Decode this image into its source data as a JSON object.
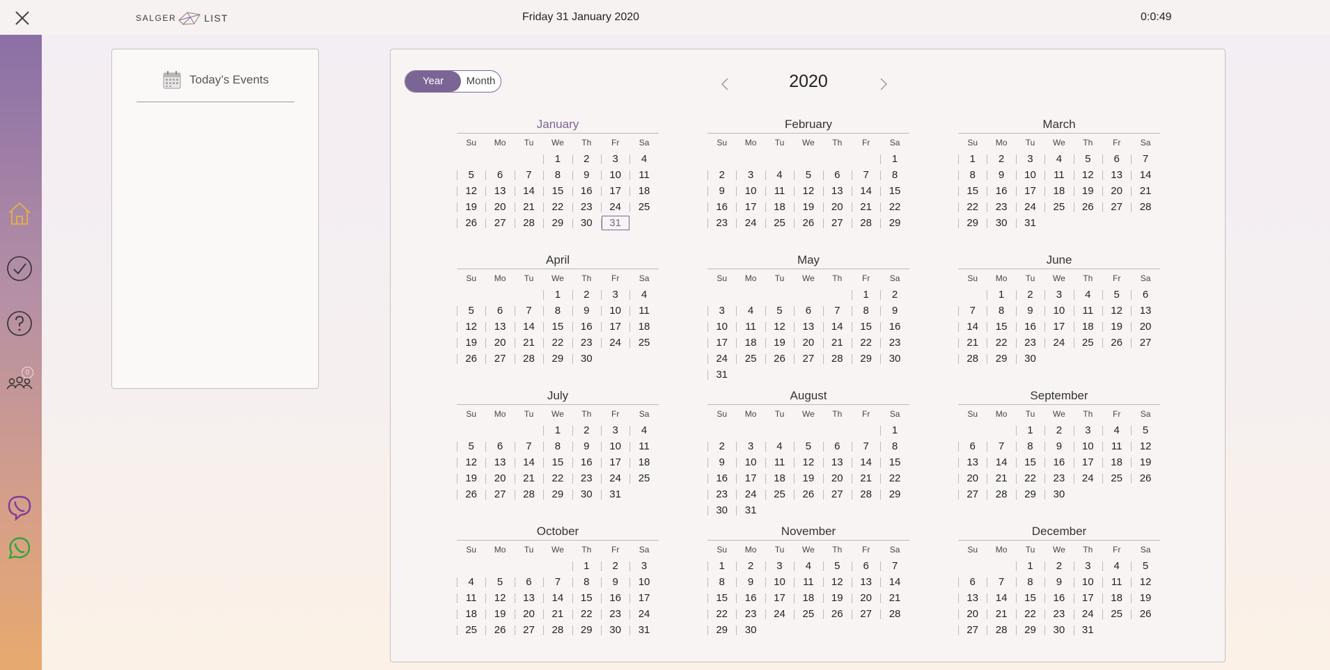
{
  "topbar": {
    "logo_left": "SALGER",
    "logo_right": "LIST",
    "date": "Friday 31 January 2020",
    "timer": "0:0:49"
  },
  "sidebar": {
    "icons": [
      "home-icon",
      "check-circle-icon",
      "help-icon",
      "people-icon",
      "viber-icon",
      "whatsapp-icon"
    ],
    "badge": "0"
  },
  "events": {
    "title": "Today’s Events"
  },
  "calendar": {
    "toggle": {
      "year": "Year",
      "month": "Month",
      "active": "Year"
    },
    "year": "2020",
    "weekday_labels": [
      "Su",
      "Mo",
      "Tu",
      "We",
      "Th",
      "Fr",
      "Sa"
    ],
    "today": {
      "month": "January",
      "day": 31
    },
    "accent": "#7b6595",
    "months": [
      {
        "name": "January",
        "offset": 3,
        "days": 31
      },
      {
        "name": "February",
        "offset": 6,
        "days": 29
      },
      {
        "name": "March",
        "offset": 0,
        "days": 31
      },
      {
        "name": "April",
        "offset": 3,
        "days": 30
      },
      {
        "name": "May",
        "offset": 5,
        "days": 31
      },
      {
        "name": "June",
        "offset": 1,
        "days": 30
      },
      {
        "name": "July",
        "offset": 3,
        "days": 31
      },
      {
        "name": "August",
        "offset": 6,
        "days": 31
      },
      {
        "name": "September",
        "offset": 2,
        "days": 30
      },
      {
        "name": "October",
        "offset": 4,
        "days": 31
      },
      {
        "name": "November",
        "offset": 0,
        "days": 30
      },
      {
        "name": "December",
        "offset": 2,
        "days": 31
      }
    ]
  }
}
